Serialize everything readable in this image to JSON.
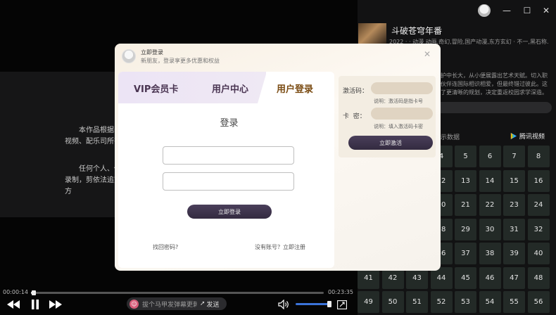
{
  "player": {
    "notice_p1": "本作品根据画面、视频、配乐司所有。",
    "notice_p2": "任何个人、修改，录制，剪依法追究侵权方",
    "time_current": "00:00:14",
    "time_total": "00:23:35",
    "progress": 0.01,
    "volume": 1.0,
    "danmu_placeholder": "拔个马甲发弹幕更刺激",
    "send_label": "发送"
  },
  "show": {
    "title": "斗破苍穹年番",
    "meta": "2022 · · 动漫 动画,奇幻,冒险,国产动漫,东方玄幻 · 不一,黑石称.",
    "desc": "护中长大，从小便展露出艺术天赋。切入职伙伴连国际相识相爱，但最终错过彼此。这了更清晰的规划，决定重返校园求学深造。",
    "episodes_label": "示数据",
    "source_label": "腾讯视频",
    "episodes": [
      4,
      5,
      6,
      7,
      8,
      12,
      13,
      14,
      15,
      16,
      20,
      21,
      22,
      23,
      24,
      28,
      29,
      30,
      31,
      32,
      36,
      37,
      38,
      39,
      40,
      41,
      42,
      43,
      44,
      45,
      46,
      47,
      48,
      49,
      50,
      51,
      52,
      53,
      54,
      55,
      56
    ]
  },
  "modal": {
    "header_title": "立即登录",
    "header_sub": "新朋友，登录享更多优惠和权益",
    "tabs": [
      "VIP会员卡",
      "用户中心",
      "用户登录"
    ],
    "login_title": "登录",
    "username_value": "",
    "password_value": "",
    "login_button": "立即登录",
    "forgot_link": "找回密码?",
    "register_link": "没有账号？立即注册",
    "activation": {
      "code_label": "激活码：",
      "code_hint": "说明：激活码是指卡号",
      "pin_label": "卡  密：",
      "pin_hint": "说明：填入激活码卡密",
      "button": "立即激活"
    }
  },
  "colors": {
    "accent_dark": "#3a3148",
    "tab_active": "#7a4b12",
    "episode_bg": "#232a27",
    "volume": "#3b73d9"
  }
}
